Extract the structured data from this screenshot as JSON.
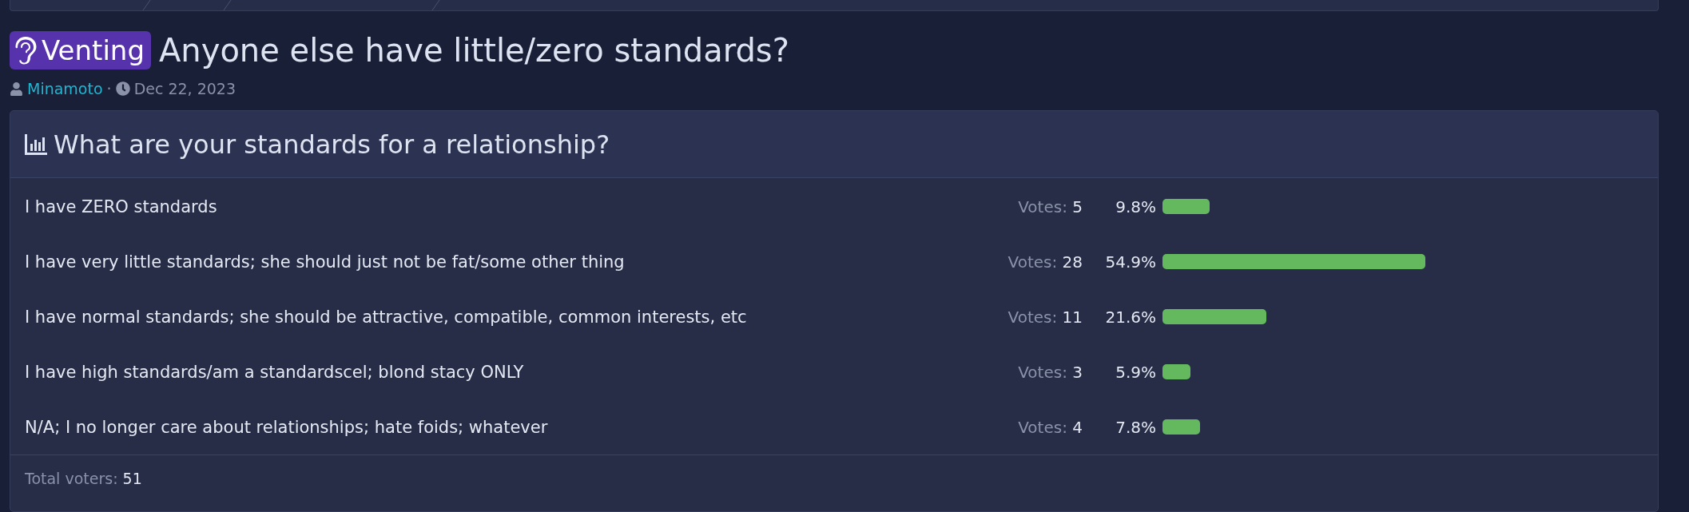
{
  "thread": {
    "prefix": "Venting",
    "title": "Anyone else have little/zero standards?",
    "author": "Minamoto",
    "separator": "·",
    "date": "Dec 22, 2023"
  },
  "poll": {
    "question": "What are your standards for a relationship?",
    "options": [
      {
        "text": "I have ZERO standards",
        "votes_label": "Votes:",
        "votes": "5",
        "percent": "9.8%"
      },
      {
        "text": "I have very little standards; she should just not be fat/some other thing",
        "votes_label": "Votes:",
        "votes": "28",
        "percent": "54.9%"
      },
      {
        "text": "I have normal standards; she should be attractive, compatible, common interests, etc",
        "votes_label": "Votes:",
        "votes": "11",
        "percent": "21.6%"
      },
      {
        "text": "I have high standards/am a standardscel; blond stacy ONLY",
        "votes_label": "Votes:",
        "votes": "3",
        "percent": "5.9%"
      },
      {
        "text": "N/A; I no longer care about relationships; hate foids; whatever",
        "votes_label": "Votes:",
        "votes": "4",
        "percent": "7.8%"
      }
    ],
    "total_label": "Total voters:",
    "total": "51"
  }
}
